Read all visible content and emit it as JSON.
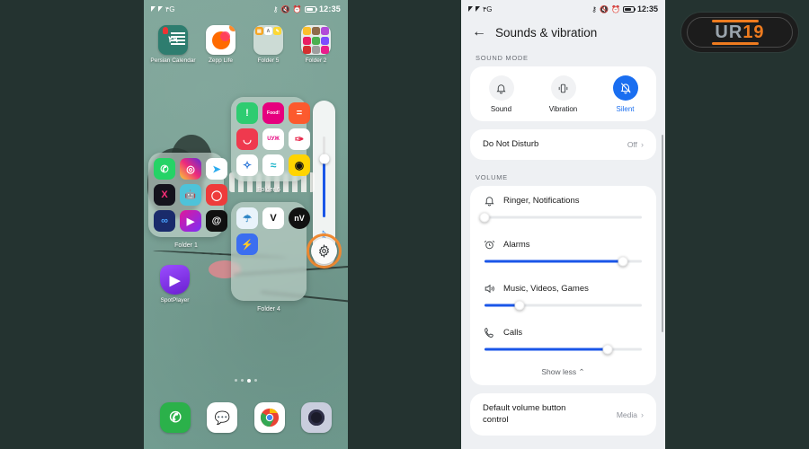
{
  "background_color": "#243330",
  "home_screen": {
    "status_bar": {
      "left_icons": [
        "signal-icon",
        "signal-icon"
      ],
      "network_label": "۴G",
      "right_icons": [
        "key-icon",
        "mute-icon",
        "alarm-icon",
        "battery-icon"
      ],
      "time": "12:35"
    },
    "row1": [
      {
        "label": "Persian Calendar",
        "icon": "persian-calendar-icon",
        "glyph": "۲۹",
        "bg": "#2e7d6f"
      },
      {
        "label": "Zepp Life",
        "icon": "zepp-life-icon",
        "glyph": "",
        "bg": "#ffffff"
      },
      {
        "label": "Folder 5",
        "icon": "folder-icon",
        "glyph": "",
        "bg": "#d7e2dc"
      },
      {
        "label": "Folder 2",
        "icon": "folder-icon",
        "glyph": "",
        "bg": "#f2f2f2"
      }
    ],
    "folder6": {
      "label": "Folder 6",
      "apps": [
        {
          "name": "snapp-icon",
          "glyph": "!",
          "bg": "#2ecc71"
        },
        {
          "name": "foodit-icon",
          "glyph": "Food!",
          "bg": "#e6007e"
        },
        {
          "name": "divar-icon",
          "glyph": "=",
          "bg": "#fc5a2e"
        },
        {
          "name": "digikala-icon",
          "glyph": "◡",
          "bg": "#ef394e"
        },
        {
          "name": "uup-icon",
          "glyph": "UУЖ",
          "bg": "#ffffff"
        },
        {
          "name": "sheypoor-icon",
          "glyph": "✑",
          "bg": "#ffffff"
        },
        {
          "name": "bank-blue-icon",
          "glyph": "✧",
          "bg": "#ffffff"
        },
        {
          "name": "tapsi-icon",
          "glyph": "≈",
          "bg": "#ffffff"
        },
        {
          "name": "cafe-bazaar-icon",
          "glyph": "◉",
          "bg": "#ffd400"
        }
      ]
    },
    "folder1": {
      "label": "Folder 1",
      "apps": [
        {
          "name": "whatsapp-icon",
          "glyph": "✆",
          "bg": "#25d366"
        },
        {
          "name": "instagram-icon",
          "glyph": "◎",
          "bg": "#d62976"
        },
        {
          "name": "telegram-icon",
          "glyph": "➤",
          "bg": "#2aabee"
        },
        {
          "name": "x-twitter-icon",
          "glyph": "X",
          "bg": "#14121c"
        },
        {
          "name": "robot-icon",
          "glyph": "🤖",
          "bg": "#4ec3d9"
        },
        {
          "name": "eitaa-icon",
          "glyph": "◯",
          "bg": "#ee3b3b"
        },
        {
          "name": "soroush-icon",
          "glyph": "∞",
          "bg": "#1a2b6b"
        },
        {
          "name": "rubika-icon",
          "glyph": "▶",
          "bg": "#e0189a"
        },
        {
          "name": "threads-icon",
          "glyph": "@",
          "bg": "#101010"
        }
      ]
    },
    "folder4": {
      "label": "Folder 4",
      "apps": [
        {
          "name": "shaparak-icon",
          "glyph": "☂",
          "bg": "#e9f3fb"
        },
        {
          "name": "vpn-check-icon",
          "glyph": "V",
          "bg": "#ffffff"
        },
        {
          "name": "nv-icon",
          "glyph": "nV",
          "bg": "#111111"
        },
        {
          "name": "flash-vpn-icon",
          "glyph": "⚡",
          "bg": "#3b6ef0"
        }
      ]
    },
    "spotplayer": {
      "label": "SpotPlayer",
      "icon": "spotplayer-shield-icon",
      "glyph": "▶",
      "bg": "#7b2ff7"
    },
    "volume_panel": {
      "slider_fill_percent": 72,
      "bluetooth_icon": "bluetooth-icon",
      "settings_icon": "gear-icon",
      "highlight_color": "#ef8a33"
    },
    "page_dots": {
      "count": 4,
      "active_index": 2
    },
    "dock": [
      {
        "name": "phone-icon",
        "glyph": "✆",
        "bg": "#2bb14a"
      },
      {
        "name": "messages-icon",
        "glyph": "💬",
        "bg": "#ffffff"
      },
      {
        "name": "chrome-icon",
        "glyph": "◉",
        "bg": "#ffffff"
      },
      {
        "name": "camera-icon",
        "glyph": "◎",
        "bg": "#c9cddd"
      }
    ]
  },
  "settings_screen": {
    "status_bar": {
      "network_label": "۴G",
      "time": "12:35"
    },
    "header": {
      "back_icon": "back-arrow-icon",
      "title": "Sounds & vibration"
    },
    "sound_mode": {
      "section_label": "SOUND MODE",
      "modes": [
        {
          "label": "Sound",
          "icon": "bell-icon",
          "active": false
        },
        {
          "label": "Vibration",
          "icon": "vibration-icon",
          "active": false
        },
        {
          "label": "Silent",
          "icon": "bell-slash-icon",
          "active": true
        }
      ],
      "active_color": "#1a6ef0"
    },
    "do_not_disturb": {
      "label": "Do Not Disturb",
      "value": "Off",
      "chevron": "›"
    },
    "volume": {
      "section_label": "VOLUME",
      "sliders": [
        {
          "label": "Ringer, Notifications",
          "icon": "bell-icon",
          "value": 0
        },
        {
          "label": "Alarms",
          "icon": "alarm-clock-icon",
          "value": 88
        },
        {
          "label": "Music, Videos, Games",
          "icon": "speaker-icon",
          "value": 22
        },
        {
          "label": "Calls",
          "icon": "phone-handset-icon",
          "value": 78
        }
      ],
      "show_less_label": "Show less",
      "show_less_icon": "chevron-up-icon"
    },
    "default_volume_button": {
      "label": "Default volume button control",
      "value": "Media",
      "chevron": "›"
    },
    "accent_color": "#1a56e8"
  },
  "logo": {
    "text_part1": "UR",
    "text_part2": "19",
    "accent": "#ee7b1f",
    "gray": "#9aa4ad"
  }
}
